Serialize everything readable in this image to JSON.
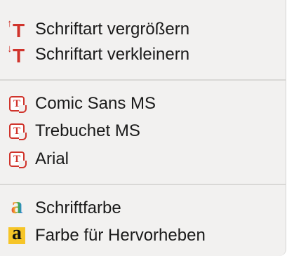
{
  "menu": {
    "size_group": [
      {
        "label": "Schriftart vergrößern",
        "icon": "font-size-increase-icon"
      },
      {
        "label": "Schriftart verkleinern",
        "icon": "font-size-decrease-icon"
      }
    ],
    "font_group": [
      {
        "label": "Comic Sans MS",
        "icon": "font-icon"
      },
      {
        "label": "Trebuchet MS",
        "icon": "font-icon"
      },
      {
        "label": "Arial",
        "icon": "font-icon"
      }
    ],
    "color_group": [
      {
        "label": "Schriftfarbe",
        "icon": "text-color-icon"
      },
      {
        "label": "Farbe für Hervorheben",
        "icon": "highlight-color-icon"
      }
    ]
  },
  "colors": {
    "menu_background": "#f2f1f0",
    "icon_red": "#d0342c",
    "highlight_yellow": "#f6c528"
  }
}
